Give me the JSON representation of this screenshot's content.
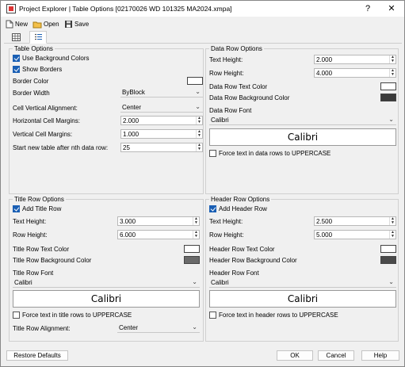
{
  "window": {
    "title": "Project Explorer | Table Options [02170026 WD 101325 MA2024.xmpa]",
    "help_glyph": "?",
    "close_glyph": "✕"
  },
  "toolbar": {
    "new_label": "New",
    "open_label": "Open",
    "save_label": "Save"
  },
  "table_options": {
    "title": "Table Options",
    "use_background_colors": {
      "label": "Use Background Colors",
      "checked": true
    },
    "show_borders": {
      "label": "Show Borders",
      "checked": true
    },
    "border_color_label": "Border Color",
    "border_color": "#ffffff",
    "border_width_label": "Border Width",
    "border_width_value": "ByBlock",
    "cell_vertical_alignment_label": "Cell Vertical Alignment:",
    "cell_vertical_alignment_value": "Center",
    "horizontal_cell_margins_label": "Horizontal Cell Margins:",
    "horizontal_cell_margins_value": "2.000",
    "vertical_cell_margins_label": "Vertical Cell Margins:",
    "vertical_cell_margins_value": "1.000",
    "start_new_table_label": "Start new table after nth data row:",
    "start_new_table_value": "25"
  },
  "data_row_options": {
    "title": "Data Row Options",
    "text_height_label": "Text Height:",
    "text_height_value": "2.000",
    "row_height_label": "Row Height:",
    "row_height_value": "4.000",
    "text_color_label": "Data Row Text Color",
    "text_color": "#ffffff",
    "background_color_label": "Data Row Background Color",
    "background_color": "#3a3a3a",
    "font_label": "Data Row Font",
    "font_value": "Calibri",
    "font_preview": "Calibri",
    "uppercase": {
      "label": "Force text in data rows to UPPERCASE",
      "checked": false
    }
  },
  "title_row_options": {
    "title": "Title Row Options",
    "add": {
      "label": "Add Title Row",
      "checked": true
    },
    "text_height_label": "Text Height:",
    "text_height_value": "3.000",
    "row_height_label": "Row Height:",
    "row_height_value": "6.000",
    "text_color_label": "Title Row Text Color",
    "text_color": "#ffffff",
    "background_color_label": "Title Row Background Color",
    "background_color": "#6a6a6a",
    "font_label": "Title Row Font",
    "font_value": "Calibri",
    "font_preview": "Calibri",
    "uppercase": {
      "label": "Force text in title rows to UPPERCASE",
      "checked": false
    },
    "alignment_label": "Title Row Alignment:",
    "alignment_value": "Center"
  },
  "header_row_options": {
    "title": "Header Row Options",
    "add": {
      "label": "Add Header Row",
      "checked": true
    },
    "text_height_label": "Text Height:",
    "text_height_value": "2.500",
    "row_height_label": "Row Height:",
    "row_height_value": "5.000",
    "text_color_label": "Header Row Text Color",
    "text_color": "#ffffff",
    "background_color_label": "Header Row Background Color",
    "background_color": "#4a4a4a",
    "font_label": "Header Row Font",
    "font_value": "Calibri",
    "font_preview": "Calibri",
    "uppercase": {
      "label": "Force text in header rows to UPPERCASE",
      "checked": false
    }
  },
  "footer": {
    "restore_defaults_label": "Restore Defaults",
    "ok_label": "OK",
    "cancel_label": "Cancel",
    "help_label": "Help"
  }
}
